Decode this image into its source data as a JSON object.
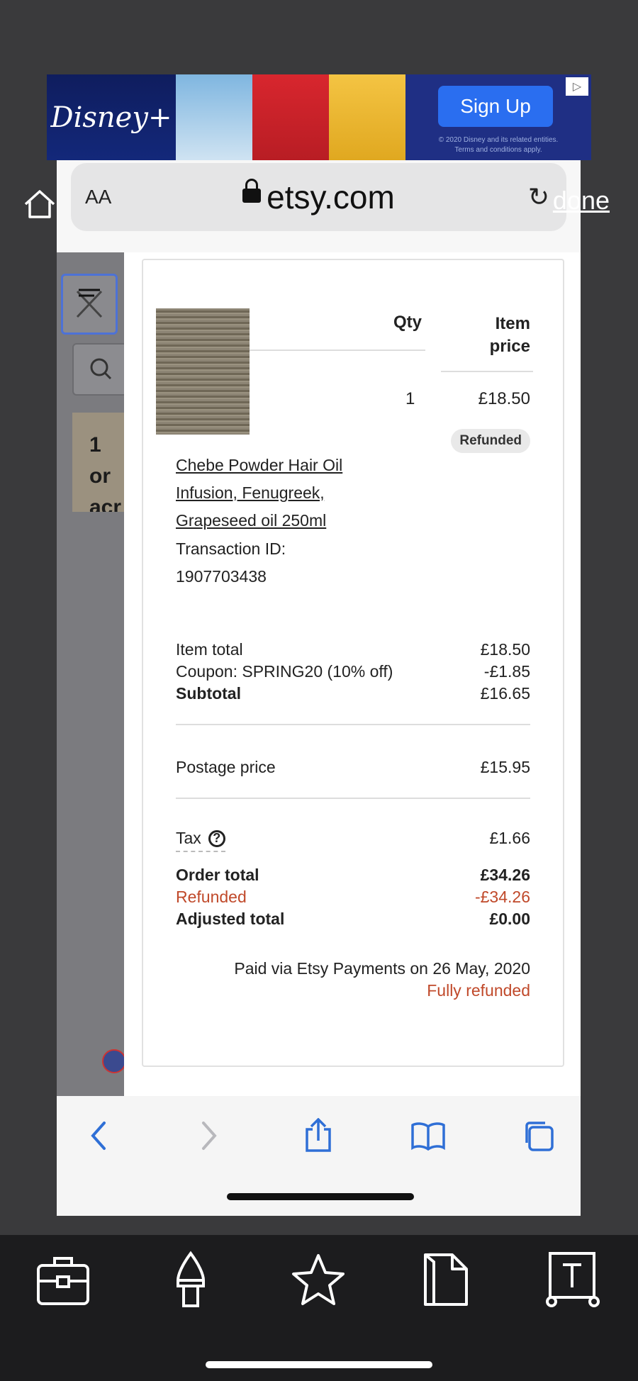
{
  "ad": {
    "brand": "Disney+",
    "cta": "Sign Up",
    "fineprint_1": "© 2020 Disney and its related entities.",
    "fineprint_2": "Terms and conditions apply."
  },
  "browser": {
    "text_size_label": "AA",
    "domain": "etsy.com",
    "done_label": "done"
  },
  "page_behind": {
    "banner_text_1": "1 or",
    "banner_text_2": "acr"
  },
  "receipt": {
    "header_qty": "Qty",
    "header_item": "Item",
    "header_price": "price",
    "qty": "1",
    "item_price": "£18.50",
    "status_badge": "Refunded",
    "product_name": "Chebe Powder Hair Oil Infusion, Fenugreek, Grapeseed oil 250ml",
    "transaction_label": "Transaction ID:",
    "transaction_id": "1907703438",
    "summary": {
      "item_total_label": "Item total",
      "item_total": "£18.50",
      "coupon_label": "Coupon: SPRING20 (10% off)",
      "coupon_value": "-£1.85",
      "subtotal_label": "Subtotal",
      "subtotal": "£16.65",
      "postage_label": "Postage price",
      "postage": "£15.95",
      "tax_label": "Tax",
      "tax": "£1.66",
      "order_total_label": "Order total",
      "order_total": "£34.26",
      "refunded_label": "Refunded",
      "refunded": "-£34.26",
      "adjusted_label": "Adjusted total",
      "adjusted": "£0.00"
    },
    "paid_via": "Paid via Etsy Payments on 26 May, 2020",
    "refund_status": "Fully refunded"
  },
  "colors": {
    "refund_red": "#c0492a",
    "ios_blue": "#2f6fd6"
  }
}
